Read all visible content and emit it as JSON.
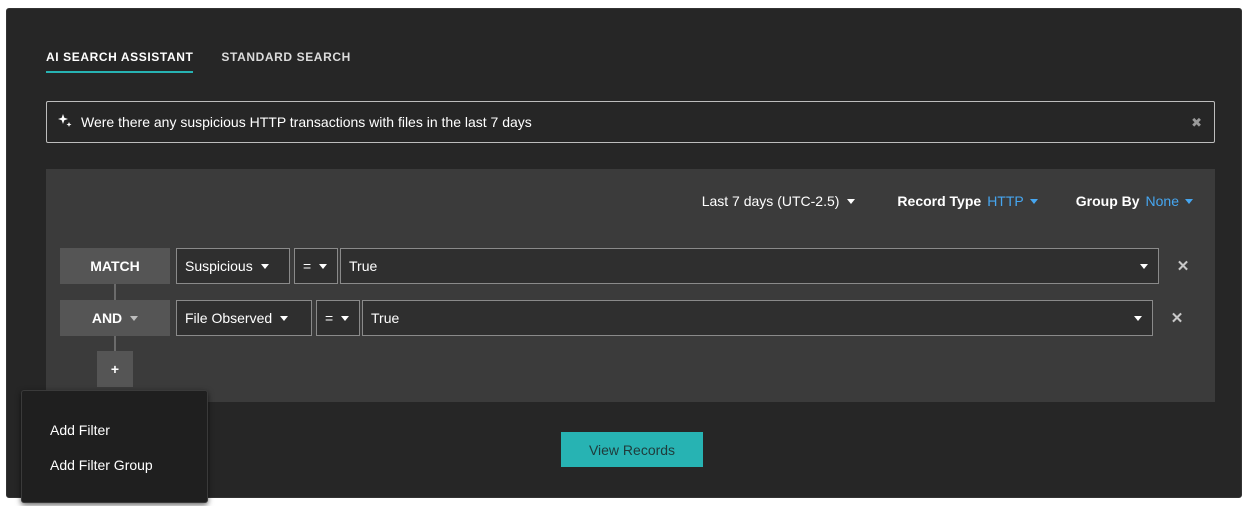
{
  "tabs": [
    {
      "label": "AI SEARCH ASSISTANT",
      "active": true
    },
    {
      "label": "STANDARD SEARCH",
      "active": false
    }
  ],
  "search": {
    "query": "Were there any suspicious HTTP transactions with files in the last 7 days",
    "icon": "sparkle-icon",
    "clear_icon": "close-icon"
  },
  "controls": {
    "time_range": "Last 7 days (UTC-2.5)",
    "record_type_label": "Record Type",
    "record_type_value": "HTTP",
    "group_by_label": "Group By",
    "group_by_value": "None"
  },
  "filters": [
    {
      "logic": "MATCH",
      "field": "Suspicious",
      "operator": "=",
      "value": "True"
    },
    {
      "logic": "AND",
      "field": "File Observed",
      "operator": "=",
      "value": "True"
    }
  ],
  "add_button": "+",
  "view_button": "View Records",
  "menu": {
    "items": [
      "Add Filter",
      "Add Filter Group"
    ]
  },
  "colors": {
    "accent": "#27b3b3",
    "link_blue": "#46a6f0",
    "panel_bg": "#262626",
    "builder_bg": "#3b3b3b"
  }
}
